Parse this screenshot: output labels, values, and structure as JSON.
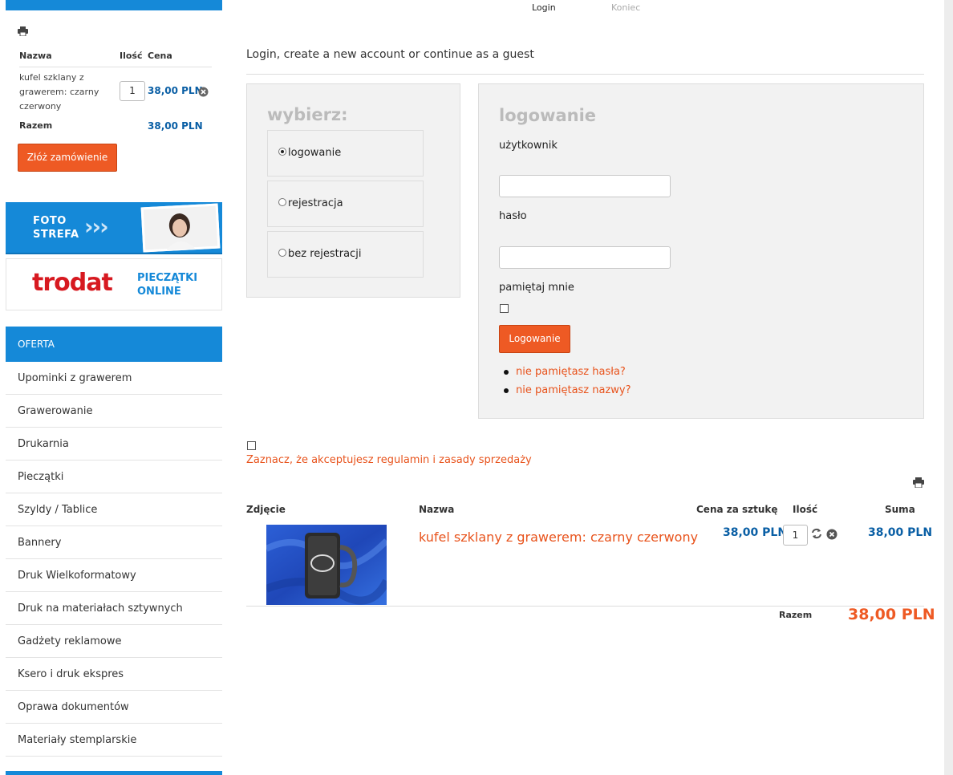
{
  "steps": {
    "login": "Login",
    "end": "Koniec"
  },
  "mini_cart": {
    "headers": {
      "name": "Nazwa",
      "qty": "Ilość",
      "price": "Cena"
    },
    "item": {
      "name": "kufel szklany z grawerem: czarny czerwony",
      "qty": "1",
      "price": "38,00 PLN"
    },
    "total_label": "Razem",
    "total_value": "38,00 PLN",
    "order_button": "Złóż zamówienie"
  },
  "banners": {
    "foto": {
      "line1": "FOTO",
      "line2": "STREFA"
    },
    "trodat": {
      "logo": "trodat",
      "line1": "PIECZĄTKI",
      "line2": "ONLINE"
    }
  },
  "menu": {
    "heading": "OFERTA",
    "items": [
      "Upominki z grawerem",
      "Grawerowanie",
      "Drukarnia",
      "Pieczątki",
      "Szyldy / Tablice",
      "Bannery",
      "Druk Wielkoformatowy",
      "Druk na materiałach sztywnych",
      "Gadżety reklamowe",
      "Ksero i druk ekspres",
      "Oprawa dokumentów",
      "Materiały stemplarskie"
    ]
  },
  "main": {
    "title": "Login, create a new account or continue as a guest",
    "choose": {
      "title": "wybierz:",
      "options": [
        "logowanie",
        "rejestracja",
        "bez rejestracji"
      ],
      "selected": "logowanie"
    },
    "login": {
      "title": "logowanie",
      "user_label": "użytkownik",
      "user_value": "",
      "password_label": "hasło",
      "password_value": "",
      "remember_label": "pamiętaj mnie",
      "button": "Logowanie",
      "links": [
        "nie pamiętasz hasła?",
        "nie pamiętasz nazwy?"
      ]
    },
    "tos": "Zaznacz, że akceptujesz regulamin i zasady sprzedaży",
    "cart": {
      "headers": {
        "photo": "Zdjęcie",
        "name": "Nazwa",
        "unit_price": "Cena za sztukę",
        "qty": "Ilość",
        "sum": "Suma"
      },
      "item": {
        "name": "kufel szklany z grawerem: czarny czerwony",
        "unit_price": "38,00 PLN",
        "qty": "1",
        "sum": "38,00 PLN"
      },
      "total_label": "Razem",
      "total_value": "38,00 PLN"
    }
  },
  "colors": {
    "brand_blue": "#1589d8",
    "accent_orange": "#ee5a24",
    "price_blue": "#0a5fa5"
  }
}
